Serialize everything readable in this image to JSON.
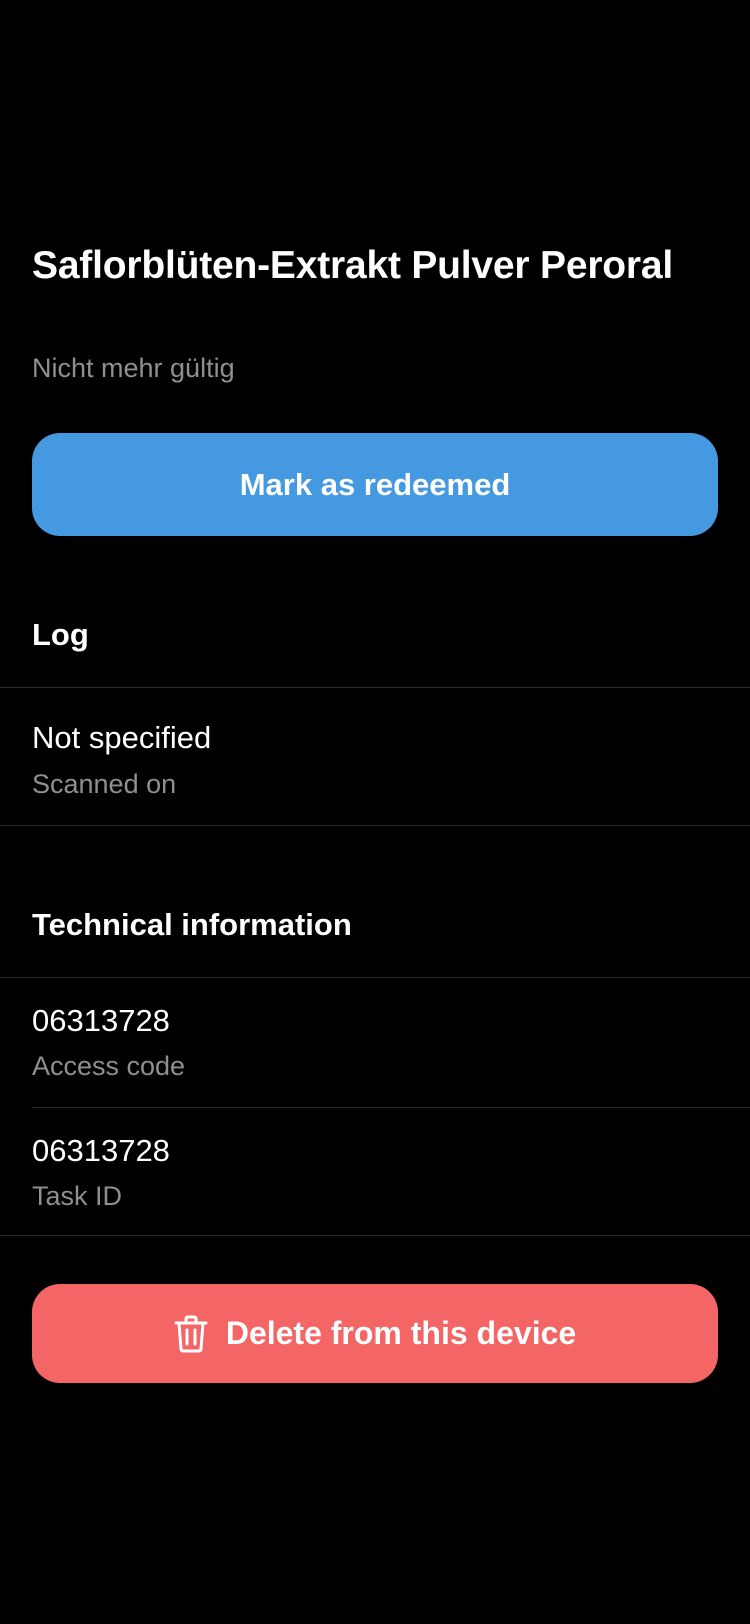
{
  "header": {
    "title": "Saflorblüten-Extrakt Pulver Peroral",
    "status": "Nicht mehr gültig"
  },
  "actions": {
    "redeem_label": "Mark as redeemed",
    "delete_label": "Delete from this device",
    "delete_icon": "trash-icon"
  },
  "log": {
    "heading": "Log",
    "items": [
      {
        "value": "Not specified",
        "label": "Scanned on"
      }
    ]
  },
  "technical": {
    "heading": "Technical information",
    "items": [
      {
        "value": "06313728",
        "label": "Access code"
      },
      {
        "value": "06313728",
        "label": "Task ID"
      }
    ]
  },
  "colors": {
    "background": "#000000",
    "primary": "#4599e0",
    "danger": "#f46565",
    "secondary_text": "#8e8e93",
    "separator": "#2b2b2e"
  }
}
